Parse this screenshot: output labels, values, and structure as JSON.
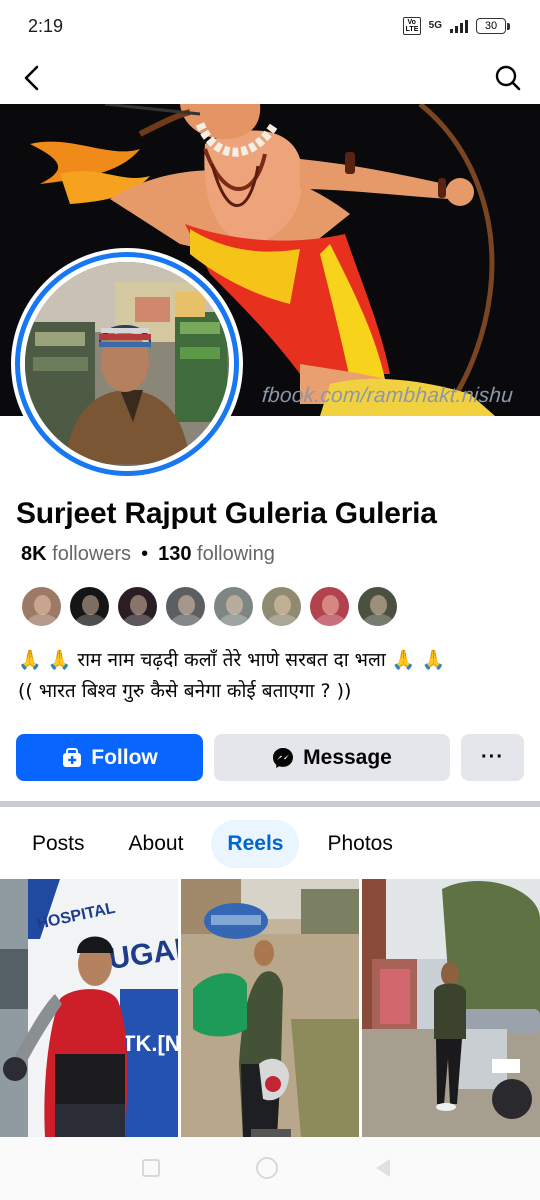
{
  "status_bar": {
    "time": "2:19",
    "volte": "Vo LTE",
    "network": "5G",
    "battery": "30"
  },
  "nav": {
    "back_icon": "chevron-left-icon",
    "search_icon": "search-icon"
  },
  "cover": {
    "watermark": "fbook.com/rambhakt.nishu"
  },
  "profile": {
    "name": "Surjeet Rajput Guleria Guleria",
    "followers_count": "8K",
    "followers_label": "followers",
    "separator": "•",
    "following_count": "130",
    "following_label": "following",
    "bio_line1": "🙏 🙏 राम नाम चढ़दी कलाँ तेरे भाणे सरबत दा भला 🙏 🙏",
    "bio_line2": "(( भारत बिश्व गुरु कैसे बनेगा कोई बताएगा ? ))"
  },
  "friends": [
    {
      "name": "friend-1",
      "color": "#9c7a66"
    },
    {
      "name": "friend-2",
      "color": "#151515"
    },
    {
      "name": "friend-3",
      "color": "#2a1e24"
    },
    {
      "name": "friend-4",
      "color": "#5c5f62"
    },
    {
      "name": "friend-5",
      "color": "#7d8683"
    },
    {
      "name": "friend-6",
      "color": "#8f8a72"
    },
    {
      "name": "friend-7",
      "color": "#b3424f"
    },
    {
      "name": "friend-8",
      "color": "#4b5140"
    }
  ],
  "actions": {
    "follow_label": "Follow",
    "message_label": "Message",
    "more_label": "···"
  },
  "tabs": [
    {
      "label": "Posts",
      "active": false
    },
    {
      "label": "About",
      "active": false
    },
    {
      "label": "Reels",
      "active": true
    },
    {
      "label": "Photos",
      "active": false
    }
  ],
  "reels": {
    "reel1_sign_1": "HOSPITAL",
    "reel1_sign_2": "UGAR",
    "reel1_sign_3": "TK.[N"
  },
  "colors": {
    "accent": "#0866ff",
    "ring": "#1877f2",
    "tab_active_bg": "#ebf5ff",
    "tab_active_text": "#0064d1"
  }
}
